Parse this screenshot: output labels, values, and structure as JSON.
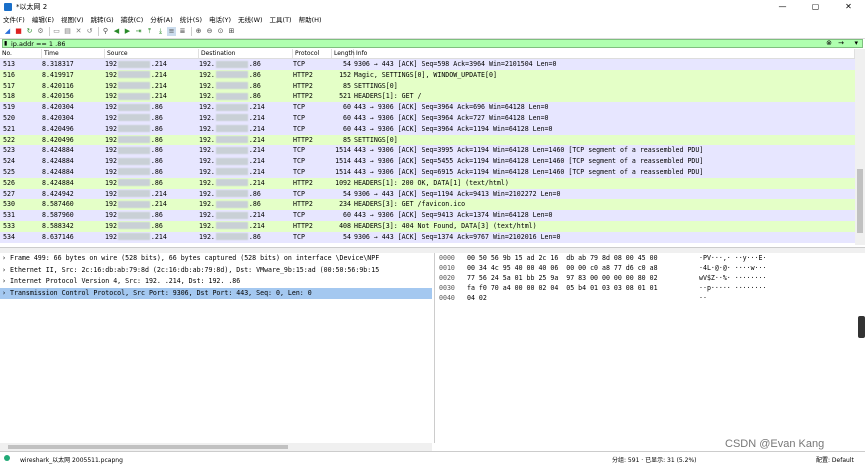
{
  "window": {
    "title": "*以太网 2",
    "minimize": "—",
    "maximize": "▢",
    "close": "✕"
  },
  "menu": [
    "文件(F)",
    "编辑(E)",
    "视图(V)",
    "跳转(G)",
    "捕获(C)",
    "分析(A)",
    "统计(S)",
    "电话(Y)",
    "无线(W)",
    "工具(T)",
    "帮助(H)"
  ],
  "filter": {
    "value": "ip.addr == 1          .86"
  },
  "columns": [
    "No.",
    "Time",
    "Source",
    "Destination",
    "Protocol",
    "Length",
    "Info"
  ],
  "colors": {
    "tcp_row": "#e7e6ff",
    "http_row": "#e4ffc7",
    "selected": "#a4c8f0",
    "filter_bg": "#afffaf"
  },
  "packets": [
    {
      "no": "513",
      "time": "8.318317",
      "src_a": "192",
      "src_b": ".214",
      "dst_a": "192.",
      "dst_b": ".86",
      "proto": "TCP",
      "len": "54",
      "info": "9306 → 443 [ACK] Seq=598 Ack=3964 Win=2101504 Len=0",
      "kind": "tcp"
    },
    {
      "no": "516",
      "time": "8.419917",
      "src_a": "192",
      "src_b": ".214",
      "dst_a": "192.",
      "dst_b": ".86",
      "proto": "HTTP2",
      "len": "152",
      "info": "Magic, SETTINGS[0], WINDOW_UPDATE[0]",
      "kind": "http"
    },
    {
      "no": "517",
      "time": "8.420116",
      "src_a": "192",
      "src_b": ".214",
      "dst_a": "192.",
      "dst_b": ".86",
      "proto": "HTTP2",
      "len": "85",
      "info": "SETTINGS[0]",
      "kind": "http"
    },
    {
      "no": "518",
      "time": "8.420156",
      "src_a": "192",
      "src_b": ".214",
      "dst_a": "192.",
      "dst_b": ".86",
      "proto": "HTTP2",
      "len": "521",
      "info": "HEADERS[1]: GET /",
      "kind": "http"
    },
    {
      "no": "519",
      "time": "8.420304",
      "src_a": "192",
      "src_b": ".86",
      "dst_a": "192.",
      "dst_b": ".214",
      "proto": "TCP",
      "len": "60",
      "info": "443 → 9306 [ACK] Seq=3964 Ack=696 Win=64128 Len=0",
      "kind": "tcp"
    },
    {
      "no": "520",
      "time": "8.420304",
      "src_a": "192",
      "src_b": ".86",
      "dst_a": "192.",
      "dst_b": ".214",
      "proto": "TCP",
      "len": "60",
      "info": "443 → 9306 [ACK] Seq=3964 Ack=727 Win=64128 Len=0",
      "kind": "tcp"
    },
    {
      "no": "521",
      "time": "8.420496",
      "src_a": "192",
      "src_b": ".86",
      "dst_a": "192.",
      "dst_b": ".214",
      "proto": "TCP",
      "len": "60",
      "info": "443 → 9306 [ACK] Seq=3964 Ack=1194 Win=64128 Len=0",
      "kind": "tcp"
    },
    {
      "no": "522",
      "time": "8.420496",
      "src_a": "192",
      "src_b": ".86",
      "dst_a": "192.",
      "dst_b": ".214",
      "proto": "HTTP2",
      "len": "85",
      "info": "SETTINGS[0]",
      "kind": "http"
    },
    {
      "no": "523",
      "time": "8.424884",
      "src_a": "192",
      "src_b": ".86",
      "dst_a": "192.",
      "dst_b": ".214",
      "proto": "TCP",
      "len": "1514",
      "info": "443 → 9306 [ACK] Seq=3995 Ack=1194 Win=64128 Len=1460 [TCP segment of a reassembled PDU]",
      "kind": "tcp"
    },
    {
      "no": "524",
      "time": "8.424884",
      "src_a": "192",
      "src_b": ".86",
      "dst_a": "192.",
      "dst_b": ".214",
      "proto": "TCP",
      "len": "1514",
      "info": "443 → 9306 [ACK] Seq=5455 Ack=1194 Win=64128 Len=1460 [TCP segment of a reassembled PDU]",
      "kind": "tcp"
    },
    {
      "no": "525",
      "time": "8.424884",
      "src_a": "192",
      "src_b": ".86",
      "dst_a": "192.",
      "dst_b": ".214",
      "proto": "TCP",
      "len": "1514",
      "info": "443 → 9306 [ACK] Seq=6915 Ack=1194 Win=64128 Len=1460 [TCP segment of a reassembled PDU]",
      "kind": "tcp"
    },
    {
      "no": "526",
      "time": "8.424884",
      "src_a": "192",
      "src_b": ".86",
      "dst_a": "192.",
      "dst_b": ".214",
      "proto": "HTTP2",
      "len": "1092",
      "info": "HEADERS[1]: 200 OK, DATA[1] (text/html)",
      "kind": "http"
    },
    {
      "no": "527",
      "time": "8.424942",
      "src_a": "192",
      "src_b": ".214",
      "dst_a": "192.",
      "dst_b": ".86",
      "proto": "TCP",
      "len": "54",
      "info": "9306 → 443 [ACK] Seq=1194 Ack=9413 Win=2102272 Len=0",
      "kind": "tcp"
    },
    {
      "no": "530",
      "time": "8.587460",
      "src_a": "192",
      "src_b": ".214",
      "dst_a": "192.",
      "dst_b": ".86",
      "proto": "HTTP2",
      "len": "234",
      "info": "HEADERS[3]: GET /favicon.ico",
      "kind": "http"
    },
    {
      "no": "531",
      "time": "8.587960",
      "src_a": "192",
      "src_b": ".86",
      "dst_a": "192.",
      "dst_b": ".214",
      "proto": "TCP",
      "len": "60",
      "info": "443 → 9306 [ACK] Seq=9413 Ack=1374 Win=64128 Len=0",
      "kind": "tcp"
    },
    {
      "no": "533",
      "time": "8.588342",
      "src_a": "192",
      "src_b": ".86",
      "dst_a": "192.",
      "dst_b": ".214",
      "proto": "HTTP2",
      "len": "408",
      "info": "HEADERS[3]: 404 Not Found, DATA[3] (text/html)",
      "kind": "http"
    },
    {
      "no": "534",
      "time": "8.637146",
      "src_a": "192",
      "src_b": ".214",
      "dst_a": "192.",
      "dst_b": ".86",
      "proto": "TCP",
      "len": "54",
      "info": "9306 → 443 [ACK] Seq=1374 Ack=9767 Win=2102016 Len=0",
      "kind": "tcp"
    }
  ],
  "details": [
    {
      "text": "Frame 499: 66 bytes on wire (528 bits), 66 bytes captured (528 bits) on interface \\Device\\NPF",
      "selected": false
    },
    {
      "text": "Ethernet II, Src: 2c:16:db:ab:79:8d (2c:16:db:ab:79:8d), Dst: VMware_9b:15:ad (00:50:56:9b:15",
      "selected": false
    },
    {
      "text": "Internet Protocol Version 4, Src: 192.          .214, Dst: 192.          .86",
      "selected": false
    },
    {
      "text": "Transmission Control Protocol, Src Port: 9306, Dst Port: 443, Seq: 0, Len: 0",
      "selected": true
    }
  ],
  "hex": [
    {
      "off": "0000",
      "hex": "00 50 56 9b 15 ad 2c 16  db ab 79 8d 08 00 45 00",
      "asc": "·PV···,· ··y···E·"
    },
    {
      "off": "0010",
      "hex": "00 34 4c 95 40 00 40 06  00 00 c0 a8 77 d6 c0 a8",
      "asc": "·4L·@·@· ····w···"
    },
    {
      "off": "0020",
      "hex": "77 56 24 5a 01 bb 25 9a  97 83 00 00 00 00 80 02",
      "asc": "wV$Z··%· ········"
    },
    {
      "off": "0030",
      "hex": "fa f0 70 a4 00 00 02 04  05 b4 01 03 03 08 01 01",
      "asc": "··p····· ········"
    },
    {
      "off": "0040",
      "hex": "04 02",
      "asc": "··"
    }
  ],
  "status": {
    "file": "wireshark_以太网 2005511.pcapng",
    "packets": "分组: 591 · 已显示: 31 (5.2%)",
    "profile": "配置: Default"
  },
  "watermark": "CSDN @Evan Kang"
}
